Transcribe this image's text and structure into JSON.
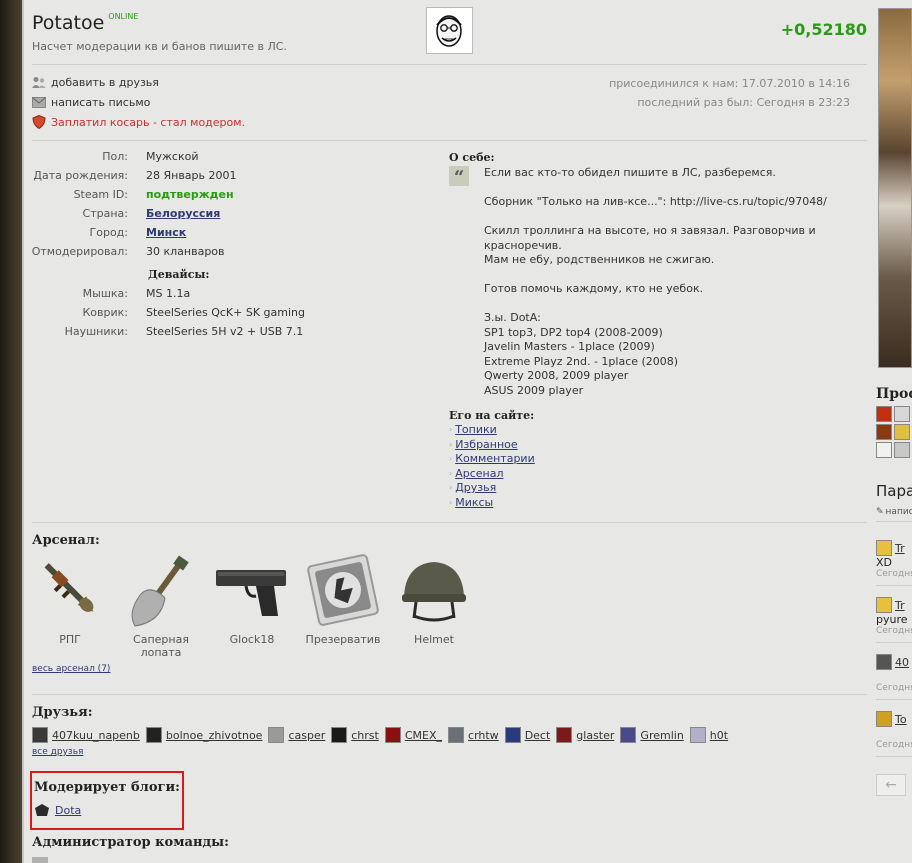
{
  "profile": {
    "name": "Potatoe",
    "online": "ONLINE",
    "status": "Насчет модерации кв и банов пишите в ЛС.",
    "rating": "+0,52180"
  },
  "actions": {
    "add_friend": "добавить в друзья",
    "write_mail": "написать письмо",
    "note": "Заплатил косарь - стал модером."
  },
  "dates": {
    "joined": "присоединился к нам: 17.07.2010 в 14:16",
    "last_seen": "последний раз был: Сегодня в 23:23"
  },
  "info": [
    {
      "label": "Пол:",
      "value": "Мужской"
    },
    {
      "label": "Дата рождения:",
      "value": "28 Январь 2001"
    },
    {
      "label": "Steam ID:",
      "value": "подтвержден"
    },
    {
      "label": "Страна:",
      "value": "Белоруссия"
    },
    {
      "label": "Город:",
      "value": "Минск"
    },
    {
      "label": "Отмодерировал:",
      "value": "30 кланваров"
    }
  ],
  "devices": {
    "title": "Девайсы:",
    "items": [
      {
        "label": "Мышка:",
        "value": "MS 1.1a"
      },
      {
        "label": "Коврик:",
        "value": "SteelSeries QcK+ SK gaming"
      },
      {
        "label": "Наушники:",
        "value": "SteelSeries 5H v2 + USB 7.1"
      }
    ]
  },
  "about": {
    "title": "О себе:",
    "quote_glyph": "“",
    "lines": [
      "Если вас кто-то обидел пишите в ЛС, разберемся.",
      "",
      "Сборник \"Только на лив-ксе...\": http://live-cs.ru/topic/97048/",
      "",
      "Скилл троллинга на высоте, но я завязал. Разговорчив и",
      "красноречив.",
      "Мам не ебу, родственников не сжигаю.",
      "",
      "Готов помочь каждому, кто не уебок.",
      "",
      "З.ы. DotA:",
      "SP1 top3, DP2 top4 (2008-2009)",
      "Javelin Masters - 1place (2009)",
      "Extreme Playz 2nd. - 1place (2008)",
      "Qwerty 2008, 2009 player",
      "ASUS 2009 player"
    ]
  },
  "onsite": {
    "title": "Его на сайте:",
    "links": [
      "Топики",
      "Избранное",
      "Комментарии",
      "Арсенал",
      "Друзья",
      "Миксы"
    ]
  },
  "arsenal": {
    "title": "Арсенал:",
    "items": [
      {
        "name": "РПГ",
        "icon": "rpg-icon"
      },
      {
        "name": "Саперная лопата",
        "icon": "shovel-icon"
      },
      {
        "name": "Glock18",
        "icon": "pistol-icon"
      },
      {
        "name": "Презерватив",
        "icon": "condom-icon"
      },
      {
        "name": "Helmet",
        "icon": "helmet-icon"
      }
    ],
    "all": "весь арсенал (7)"
  },
  "friends": {
    "title": "Друзья:",
    "list": [
      {
        "name": "407kuu_napenb",
        "color": "#3a3a3a"
      },
      {
        "name": "bolnoe_zhivotnoe",
        "color": "#222222"
      },
      {
        "name": "casper",
        "color": "#9a9a9a"
      },
      {
        "name": "chrst",
        "color": "#1a1a1a"
      },
      {
        "name": "CMEX_",
        "color": "#8a1010"
      },
      {
        "name": "crhtw",
        "color": "#6a7078"
      },
      {
        "name": "Dect",
        "color": "#2a3a7a"
      },
      {
        "name": "glaster",
        "color": "#7a1a1a"
      },
      {
        "name": "Gremlin",
        "color": "#4a4a8a"
      },
      {
        "name": "h0t",
        "color": "#b0b0c8"
      }
    ],
    "all": "все друзья"
  },
  "blogs": {
    "title": "Модерирует блоги:",
    "items": [
      "Dota"
    ]
  },
  "admin": {
    "title": "Администратор команды:"
  },
  "sidebar": {
    "profile_title": "Проф",
    "para_title": "Пара",
    "write_link": "напис",
    "comments": [
      {
        "user": "Tr",
        "text": "XD",
        "time": "Сегодня"
      },
      {
        "user": "Tr",
        "text": "pyure",
        "time": "Сегодня"
      },
      {
        "user": "40",
        "text": "",
        "time": "Сегодня"
      },
      {
        "user": "To",
        "text": "",
        "time": "Сегодня"
      }
    ],
    "prev_arrow": "←"
  },
  "colors": {
    "rating": "#2a9b13",
    "online": "#2a9b13",
    "link": "#2f3a72",
    "note": "#c43030",
    "highlight_box": "#d81a1a"
  }
}
